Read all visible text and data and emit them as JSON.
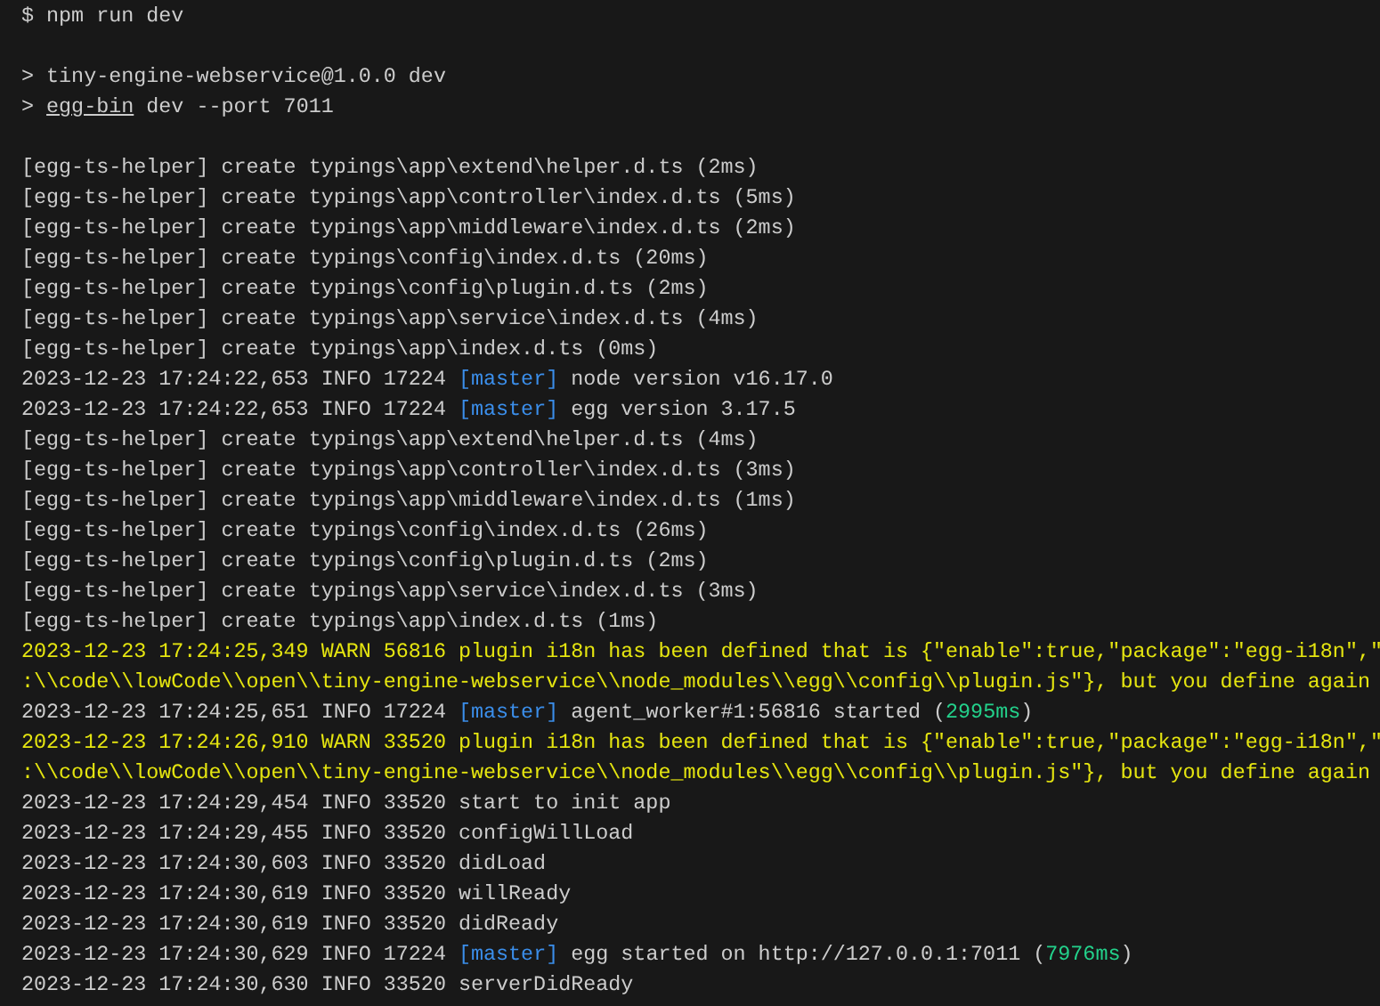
{
  "terminal": {
    "lines": [
      {
        "kind": "text",
        "spans": [
          {
            "kind": "plain",
            "text": "$ npm run dev"
          }
        ]
      },
      {
        "kind": "blank"
      },
      {
        "kind": "text",
        "spans": [
          {
            "kind": "plain",
            "text": "> tiny-engine-webservice@1.0.0 dev"
          }
        ]
      },
      {
        "kind": "text",
        "spans": [
          {
            "kind": "plain",
            "text": "> "
          },
          {
            "kind": "link",
            "text": "egg-bin"
          },
          {
            "kind": "plain",
            "text": " dev --port 7011"
          }
        ]
      },
      {
        "kind": "blank"
      },
      {
        "kind": "text",
        "spans": [
          {
            "kind": "plain",
            "text": "[egg-ts-helper] create typings\\app\\extend\\helper.d.ts (2ms)"
          }
        ]
      },
      {
        "kind": "text",
        "spans": [
          {
            "kind": "plain",
            "text": "[egg-ts-helper] create typings\\app\\controller\\index.d.ts (5ms)"
          }
        ]
      },
      {
        "kind": "text",
        "spans": [
          {
            "kind": "plain",
            "text": "[egg-ts-helper] create typings\\app\\middleware\\index.d.ts (2ms)"
          }
        ]
      },
      {
        "kind": "text",
        "spans": [
          {
            "kind": "plain",
            "text": "[egg-ts-helper] create typings\\config\\index.d.ts (20ms)"
          }
        ]
      },
      {
        "kind": "text",
        "spans": [
          {
            "kind": "plain",
            "text": "[egg-ts-helper] create typings\\config\\plugin.d.ts (2ms)"
          }
        ]
      },
      {
        "kind": "text",
        "spans": [
          {
            "kind": "plain",
            "text": "[egg-ts-helper] create typings\\app\\service\\index.d.ts (4ms)"
          }
        ]
      },
      {
        "kind": "text",
        "spans": [
          {
            "kind": "plain",
            "text": "[egg-ts-helper] create typings\\app\\index.d.ts (0ms)"
          }
        ]
      },
      {
        "kind": "text",
        "spans": [
          {
            "kind": "plain",
            "text": "2023-12-23 17:24:22,653 INFO 17224 "
          },
          {
            "kind": "tag",
            "text": "[master]"
          },
          {
            "kind": "plain",
            "text": " node version v16.17.0"
          }
        ]
      },
      {
        "kind": "text",
        "spans": [
          {
            "kind": "plain",
            "text": "2023-12-23 17:24:22,653 INFO 17224 "
          },
          {
            "kind": "tag",
            "text": "[master]"
          },
          {
            "kind": "plain",
            "text": " egg version 3.17.5"
          }
        ]
      },
      {
        "kind": "text",
        "spans": [
          {
            "kind": "plain",
            "text": "[egg-ts-helper] create typings\\app\\extend\\helper.d.ts (4ms)"
          }
        ]
      },
      {
        "kind": "text",
        "spans": [
          {
            "kind": "plain",
            "text": "[egg-ts-helper] create typings\\app\\controller\\index.d.ts (3ms)"
          }
        ]
      },
      {
        "kind": "text",
        "spans": [
          {
            "kind": "plain",
            "text": "[egg-ts-helper] create typings\\app\\middleware\\index.d.ts (1ms)"
          }
        ]
      },
      {
        "kind": "text",
        "spans": [
          {
            "kind": "plain",
            "text": "[egg-ts-helper] create typings\\config\\index.d.ts (26ms)"
          }
        ]
      },
      {
        "kind": "text",
        "spans": [
          {
            "kind": "plain",
            "text": "[egg-ts-helper] create typings\\config\\plugin.d.ts (2ms)"
          }
        ]
      },
      {
        "kind": "text",
        "spans": [
          {
            "kind": "plain",
            "text": "[egg-ts-helper] create typings\\app\\service\\index.d.ts (3ms)"
          }
        ]
      },
      {
        "kind": "text",
        "spans": [
          {
            "kind": "plain",
            "text": "[egg-ts-helper] create typings\\app\\index.d.ts (1ms)"
          }
        ]
      },
      {
        "kind": "text",
        "spans": [
          {
            "kind": "warn",
            "text": "2023-12-23 17:24:25,349 WARN 56816 plugin i18n has been defined that is {\"enable\":true,\"package\":\"egg-i18n\",\""
          }
        ]
      },
      {
        "kind": "text",
        "spans": [
          {
            "kind": "warn",
            "text": ":\\\\code\\\\lowCode\\\\open\\\\tiny-engine-webservice\\\\node_modules\\\\egg\\\\config\\\\plugin.js\"}, but you define again"
          }
        ]
      },
      {
        "kind": "text",
        "spans": [
          {
            "kind": "plain",
            "text": "2023-12-23 17:24:25,651 INFO 17224 "
          },
          {
            "kind": "tag",
            "text": "[master]"
          },
          {
            "kind": "plain",
            "text": " agent_worker#1:56816 started ("
          },
          {
            "kind": "time",
            "text": "2995ms"
          },
          {
            "kind": "plain",
            "text": ")"
          }
        ]
      },
      {
        "kind": "text",
        "spans": [
          {
            "kind": "warn",
            "text": "2023-12-23 17:24:26,910 WARN 33520 plugin i18n has been defined that is {\"enable\":true,\"package\":\"egg-i18n\",\""
          }
        ]
      },
      {
        "kind": "text",
        "spans": [
          {
            "kind": "warn",
            "text": ":\\\\code\\\\lowCode\\\\open\\\\tiny-engine-webservice\\\\node_modules\\\\egg\\\\config\\\\plugin.js\"}, but you define again"
          }
        ]
      },
      {
        "kind": "text",
        "spans": [
          {
            "kind": "plain",
            "text": "2023-12-23 17:24:29,454 INFO 33520 start to init app"
          }
        ]
      },
      {
        "kind": "text",
        "spans": [
          {
            "kind": "plain",
            "text": "2023-12-23 17:24:29,455 INFO 33520 configWillLoad"
          }
        ]
      },
      {
        "kind": "text",
        "spans": [
          {
            "kind": "plain",
            "text": "2023-12-23 17:24:30,603 INFO 33520 didLoad"
          }
        ]
      },
      {
        "kind": "text",
        "spans": [
          {
            "kind": "plain",
            "text": "2023-12-23 17:24:30,619 INFO 33520 willReady"
          }
        ]
      },
      {
        "kind": "text",
        "spans": [
          {
            "kind": "plain",
            "text": "2023-12-23 17:24:30,619 INFO 33520 didReady"
          }
        ]
      },
      {
        "kind": "text",
        "spans": [
          {
            "kind": "plain",
            "text": "2023-12-23 17:24:30,629 INFO 17224 "
          },
          {
            "kind": "tag",
            "text": "[master]"
          },
          {
            "kind": "plain",
            "text": " egg started on http://127.0.0.1:7011 ("
          },
          {
            "kind": "time",
            "text": "7976ms"
          },
          {
            "kind": "plain",
            "text": ")"
          }
        ]
      },
      {
        "kind": "text",
        "spans": [
          {
            "kind": "plain",
            "text": "2023-12-23 17:24:30,630 INFO 33520 serverDidReady"
          }
        ]
      }
    ]
  }
}
